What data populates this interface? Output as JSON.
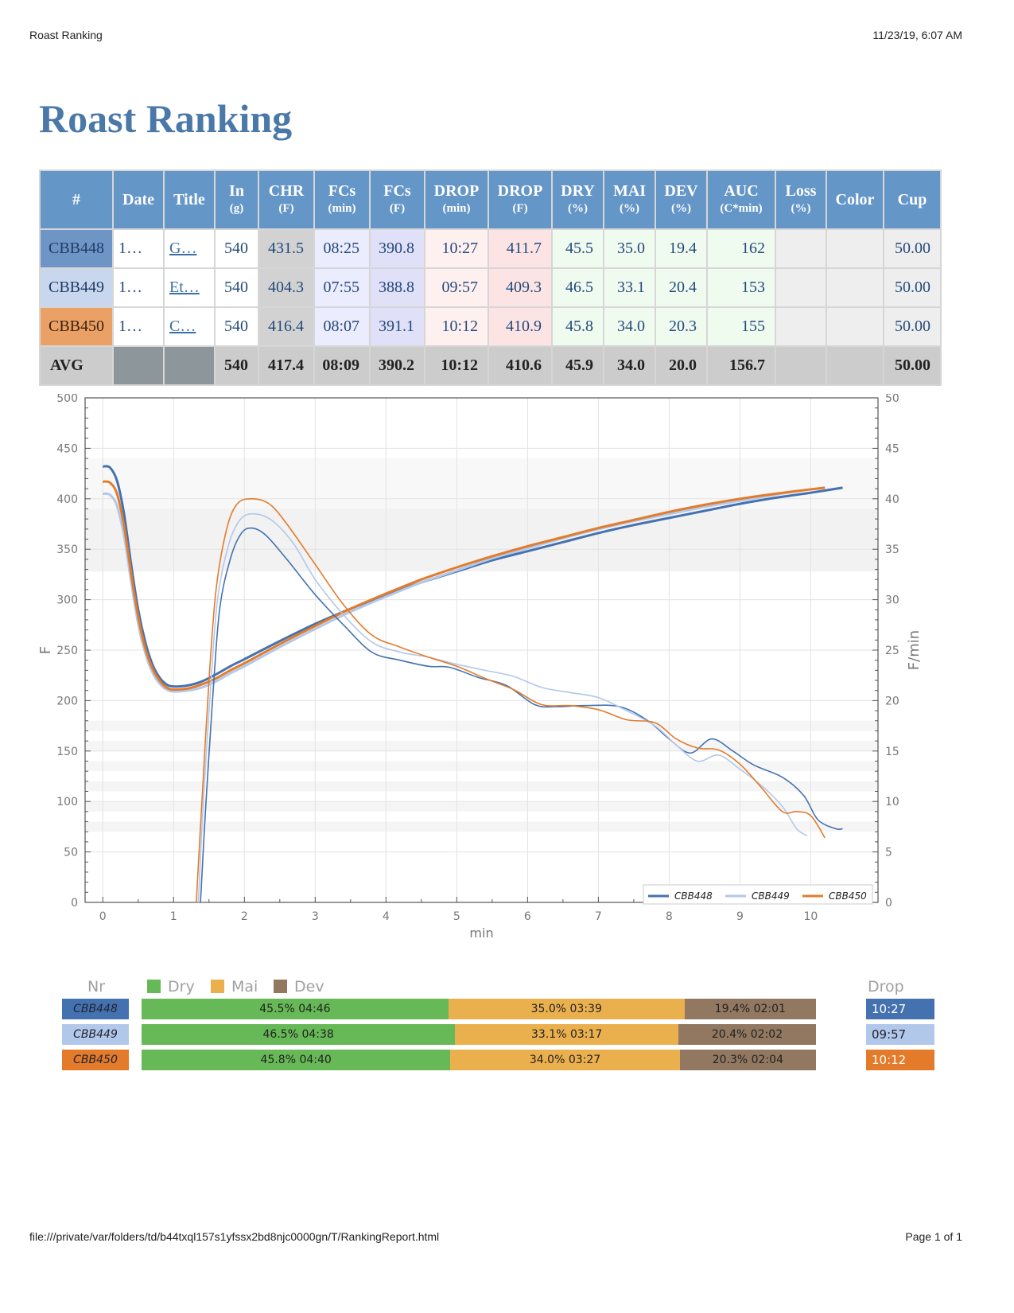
{
  "header": {
    "page_title": "Roast Ranking",
    "datetime": "11/23/19, 6:07 AM"
  },
  "footer": {
    "path": "file:///private/var/folders/td/b44txql157s1yfssx2bd8njc0000gn/T/RankingReport.html",
    "page": "Page 1 of 1"
  },
  "report": {
    "title": "Roast Ranking"
  },
  "colors": {
    "CBB448": "#4472b0",
    "CBB449": "#b2c8ea",
    "CBB450": "#e37b2a",
    "dry": "#66b956",
    "mai": "#ebb04e",
    "dev": "#927861"
  },
  "table": {
    "columns": [
      {
        "label": "#",
        "unit": ""
      },
      {
        "label": "Date",
        "unit": ""
      },
      {
        "label": "Title",
        "unit": ""
      },
      {
        "label": "In",
        "unit": "(g)"
      },
      {
        "label": "CHR",
        "unit": "(F)"
      },
      {
        "label": "FCs",
        "unit": "(min)"
      },
      {
        "label": "FCs",
        "unit": "(F)"
      },
      {
        "label": "DROP",
        "unit": "(min)"
      },
      {
        "label": "DROP",
        "unit": "(F)"
      },
      {
        "label": "DRY",
        "unit": "(%)"
      },
      {
        "label": "MAI",
        "unit": "(%)"
      },
      {
        "label": "DEV",
        "unit": "(%)"
      },
      {
        "label": "AUC",
        "unit": "(C*min)"
      },
      {
        "label": "Loss",
        "unit": "(%)"
      },
      {
        "label": "Color",
        "unit": ""
      },
      {
        "label": "Cup",
        "unit": ""
      }
    ],
    "rows": [
      {
        "nr": "CBB448",
        "date": "1…",
        "title": "G…",
        "in": "540",
        "chr": "431.5",
        "fcs_min": "08:25",
        "fcs_f": "390.8",
        "drop_min": "10:27",
        "drop_f": "411.7",
        "dry": "45.5",
        "mai": "35.0",
        "dev": "19.4",
        "auc": "162",
        "loss": "",
        "color": "",
        "cup": "50.00"
      },
      {
        "nr": "CBB449",
        "date": "1…",
        "title": "Et…",
        "in": "540",
        "chr": "404.3",
        "fcs_min": "07:55",
        "fcs_f": "388.8",
        "drop_min": "09:57",
        "drop_f": "409.3",
        "dry": "46.5",
        "mai": "33.1",
        "dev": "20.4",
        "auc": "153",
        "loss": "",
        "color": "",
        "cup": "50.00"
      },
      {
        "nr": "CBB450",
        "date": "1…",
        "title": "C…",
        "in": "540",
        "chr": "416.4",
        "fcs_min": "08:07",
        "fcs_f": "391.1",
        "drop_min": "10:12",
        "drop_f": "410.9",
        "dry": "45.8",
        "mai": "34.0",
        "dev": "20.3",
        "auc": "155",
        "loss": "",
        "color": "",
        "cup": "50.00"
      }
    ],
    "avg": {
      "label": "AVG",
      "in": "540",
      "chr": "417.4",
      "fcs_min": "08:09",
      "fcs_f": "390.2",
      "drop_min": "10:12",
      "drop_f": "410.6",
      "dry": "45.9",
      "mai": "34.0",
      "dev": "20.0",
      "auc": "156.7",
      "cup": "50.00"
    }
  },
  "chart_data": {
    "type": "line",
    "xlabel": "min",
    "ylabel": "F",
    "y2label": "F/min",
    "xlim": [
      -0.25,
      10.95
    ],
    "ylim": [
      0,
      500
    ],
    "y2lim": [
      0,
      50
    ],
    "xticks": [
      0,
      1,
      2,
      3,
      4,
      5,
      6,
      7,
      8,
      9,
      10
    ],
    "yticks": [
      0,
      50,
      100,
      150,
      200,
      250,
      300,
      350,
      400,
      450,
      500
    ],
    "y2ticks": [
      0,
      5,
      10,
      15,
      20,
      25,
      30,
      35,
      40,
      45,
      50
    ],
    "grid": true,
    "legend_position": "bottom-right",
    "series": [
      {
        "name": "CBB448",
        "kind": "bt",
        "points": [
          [
            0,
            432
          ],
          [
            0.1,
            431
          ],
          [
            0.2,
            418
          ],
          [
            0.3,
            385
          ],
          [
            0.4,
            335
          ],
          [
            0.5,
            290
          ],
          [
            0.6,
            258
          ],
          [
            0.7,
            236
          ],
          [
            0.8,
            223
          ],
          [
            0.9,
            216
          ],
          [
            1.0,
            214
          ],
          [
            1.2,
            215
          ],
          [
            1.4,
            219
          ],
          [
            1.6,
            226
          ],
          [
            1.8,
            234
          ],
          [
            2.0,
            241
          ],
          [
            2.5,
            259
          ],
          [
            3.0,
            276
          ],
          [
            3.5,
            291
          ],
          [
            4.0,
            305
          ],
          [
            4.5,
            317
          ],
          [
            5.0,
            328
          ],
          [
            5.5,
            339
          ],
          [
            6.0,
            348
          ],
          [
            6.5,
            357
          ],
          [
            7.0,
            366
          ],
          [
            7.5,
            374
          ],
          [
            8.0,
            381
          ],
          [
            8.5,
            388
          ],
          [
            9.0,
            395
          ],
          [
            9.5,
            401
          ],
          [
            10.0,
            406
          ],
          [
            10.45,
            411
          ]
        ]
      },
      {
        "name": "CBB449",
        "kind": "bt",
        "points": [
          [
            0,
            405
          ],
          [
            0.1,
            404
          ],
          [
            0.2,
            393
          ],
          [
            0.3,
            363
          ],
          [
            0.4,
            318
          ],
          [
            0.5,
            276
          ],
          [
            0.6,
            247
          ],
          [
            0.7,
            228
          ],
          [
            0.8,
            217
          ],
          [
            0.9,
            211
          ],
          [
            1.0,
            209
          ],
          [
            1.2,
            210
          ],
          [
            1.4,
            213
          ],
          [
            1.6,
            219
          ],
          [
            1.8,
            227
          ],
          [
            2.0,
            234
          ],
          [
            2.5,
            253
          ],
          [
            3.0,
            271
          ],
          [
            3.5,
            288
          ],
          [
            4.0,
            303
          ],
          [
            4.5,
            317
          ],
          [
            5.0,
            329
          ],
          [
            5.5,
            341
          ],
          [
            6.0,
            351
          ],
          [
            6.5,
            361
          ],
          [
            7.0,
            370
          ],
          [
            7.5,
            378
          ],
          [
            8.0,
            385
          ],
          [
            8.5,
            392
          ],
          [
            9.0,
            398
          ],
          [
            9.5,
            404
          ],
          [
            9.95,
            409
          ]
        ]
      },
      {
        "name": "CBB450",
        "kind": "bt",
        "points": [
          [
            0,
            417
          ],
          [
            0.1,
            416
          ],
          [
            0.2,
            405
          ],
          [
            0.3,
            373
          ],
          [
            0.4,
            326
          ],
          [
            0.5,
            283
          ],
          [
            0.6,
            252
          ],
          [
            0.7,
            232
          ],
          [
            0.8,
            220
          ],
          [
            0.9,
            213
          ],
          [
            1.0,
            211
          ],
          [
            1.2,
            212
          ],
          [
            1.4,
            216
          ],
          [
            1.6,
            222
          ],
          [
            1.8,
            230
          ],
          [
            2.0,
            237
          ],
          [
            2.5,
            256
          ],
          [
            3.0,
            274
          ],
          [
            3.5,
            291
          ],
          [
            4.0,
            306
          ],
          [
            4.5,
            320
          ],
          [
            5.0,
            332
          ],
          [
            5.5,
            343
          ],
          [
            6.0,
            353
          ],
          [
            6.5,
            362
          ],
          [
            7.0,
            371
          ],
          [
            7.5,
            379
          ],
          [
            8.0,
            387
          ],
          [
            8.5,
            394
          ],
          [
            9.0,
            400
          ],
          [
            9.5,
            405
          ],
          [
            10.2,
            411
          ]
        ]
      },
      {
        "name": "CBB448",
        "kind": "ror",
        "points": [
          [
            1.38,
            0
          ],
          [
            1.45,
            9
          ],
          [
            1.55,
            20
          ],
          [
            1.65,
            29
          ],
          [
            1.8,
            34
          ],
          [
            1.95,
            36.5
          ],
          [
            2.1,
            37.1
          ],
          [
            2.3,
            36.4
          ],
          [
            2.6,
            34
          ],
          [
            3.0,
            30.5
          ],
          [
            3.4,
            27.5
          ],
          [
            3.8,
            24.8
          ],
          [
            4.2,
            24.0
          ],
          [
            4.6,
            23.4
          ],
          [
            4.9,
            23.3
          ],
          [
            5.3,
            22.3
          ],
          [
            5.7,
            21.5
          ],
          [
            6.1,
            19.6
          ],
          [
            6.4,
            19.4
          ],
          [
            6.8,
            19.5
          ],
          [
            7.3,
            19.4
          ],
          [
            7.7,
            18.0
          ],
          [
            8.0,
            16.2
          ],
          [
            8.3,
            14.8
          ],
          [
            8.6,
            16.2
          ],
          [
            8.9,
            15.0
          ],
          [
            9.2,
            13.6
          ],
          [
            9.6,
            12.4
          ],
          [
            9.9,
            10.6
          ],
          [
            10.1,
            8.2
          ],
          [
            10.35,
            7.3
          ],
          [
            10.45,
            7.3
          ]
        ]
      },
      {
        "name": "CBB449",
        "kind": "ror",
        "points": [
          [
            1.35,
            0
          ],
          [
            1.42,
            10
          ],
          [
            1.52,
            21
          ],
          [
            1.62,
            30
          ],
          [
            1.78,
            35.5
          ],
          [
            1.95,
            38
          ],
          [
            2.15,
            38.5
          ],
          [
            2.4,
            37.8
          ],
          [
            2.7,
            35.5
          ],
          [
            3.0,
            32
          ],
          [
            3.4,
            28.5
          ],
          [
            3.8,
            25.8
          ],
          [
            4.2,
            24.8
          ],
          [
            4.6,
            24.3
          ],
          [
            5.0,
            23.6
          ],
          [
            5.4,
            23.0
          ],
          [
            5.8,
            22.4
          ],
          [
            6.2,
            21.3
          ],
          [
            6.6,
            20.8
          ],
          [
            7.0,
            20.3
          ],
          [
            7.4,
            19.0
          ],
          [
            7.8,
            17.5
          ],
          [
            8.1,
            15.6
          ],
          [
            8.4,
            14.0
          ],
          [
            8.7,
            14.6
          ],
          [
            9.0,
            13.2
          ],
          [
            9.3,
            11.6
          ],
          [
            9.6,
            9.5
          ],
          [
            9.8,
            7.3
          ],
          [
            9.95,
            6.6
          ]
        ]
      },
      {
        "name": "CBB450",
        "kind": "ror",
        "points": [
          [
            1.32,
            0
          ],
          [
            1.4,
            10
          ],
          [
            1.5,
            22
          ],
          [
            1.6,
            31
          ],
          [
            1.75,
            37
          ],
          [
            1.9,
            39.5
          ],
          [
            2.1,
            40.0
          ],
          [
            2.35,
            39.5
          ],
          [
            2.6,
            37.5
          ],
          [
            3.0,
            33.5
          ],
          [
            3.4,
            29.5
          ],
          [
            3.8,
            26.5
          ],
          [
            4.2,
            25.3
          ],
          [
            4.6,
            24.3
          ],
          [
            5.0,
            23.4
          ],
          [
            5.4,
            22.2
          ],
          [
            5.8,
            21.1
          ],
          [
            6.2,
            19.6
          ],
          [
            6.6,
            19.5
          ],
          [
            7.0,
            19.1
          ],
          [
            7.4,
            18.1
          ],
          [
            7.8,
            17.8
          ],
          [
            8.1,
            16.2
          ],
          [
            8.4,
            15.3
          ],
          [
            8.7,
            15.1
          ],
          [
            9.0,
            13.7
          ],
          [
            9.3,
            11.4
          ],
          [
            9.6,
            9.0
          ],
          [
            9.8,
            9.0
          ],
          [
            10.0,
            8.6
          ],
          [
            10.2,
            6.4
          ]
        ]
      }
    ]
  },
  "phases": {
    "headers": {
      "nr": "Nr",
      "dry": "Dry",
      "mai": "Mai",
      "dev": "Dev",
      "drop": "Drop"
    },
    "rows": [
      {
        "nr": "CBB448",
        "dry_pct": 45.5,
        "mai_pct": 35.0,
        "dev_pct": 19.4,
        "dry": "45.5%  04:46",
        "mai": "35.0%  03:39",
        "dev": "19.4%  02:01",
        "drop": "10:27"
      },
      {
        "nr": "CBB449",
        "dry_pct": 46.5,
        "mai_pct": 33.1,
        "dev_pct": 20.4,
        "dry": "46.5%  04:38",
        "mai": "33.1%  03:17",
        "dev": "20.4%  02:02",
        "drop": "09:57"
      },
      {
        "nr": "CBB450",
        "dry_pct": 45.8,
        "mai_pct": 34.0,
        "dev_pct": 20.3,
        "dry": "45.8%  04:40",
        "mai": "34.0%  03:27",
        "dev": "20.3%  02:04",
        "drop": "10:12"
      }
    ]
  }
}
